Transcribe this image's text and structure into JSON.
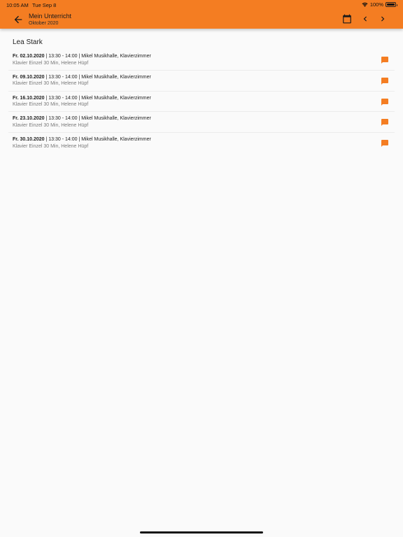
{
  "status": {
    "time": "10:05 AM",
    "date": "Tue Sep 8",
    "battery": "100%"
  },
  "header": {
    "title": "Mein Unterricht",
    "subtitle": "Oktober 2020",
    "icons": [
      "arrow-back-icon",
      "calendar-icon",
      "chevron-left-icon",
      "chevron-right-icon"
    ]
  },
  "student": {
    "name": "Lea Stark"
  },
  "lessons": [
    {
      "date": "Fr. 02.10.2020",
      "details": " | 13:30 - 14:00 | Mikel Musikhalle, Klavierzimmer",
      "subline": "Klavier Einzel 30 Min, Helene Hüpf"
    },
    {
      "date": "Fr. 09.10.2020",
      "details": " | 13:30 - 14:00 | Mikel Musikhalle, Klavierzimmer",
      "subline": "Klavier Einzel 30 Min, Helene Hüpf"
    },
    {
      "date": "Fr. 16.10.2020",
      "details": " | 13:30 - 14:00 | Mikel Musikhalle, Klavierzimmer",
      "subline": "Klavier Einzel 30 Min, Helene Hüpf"
    },
    {
      "date": "Fr. 23.10.2020",
      "details": " | 13:30 - 14:00 | Mikel Musikhalle, Klavierzimmer",
      "subline": "Klavier Einzel 30 Min, Helene Hüpf"
    },
    {
      "date": "Fr. 30.10.2020",
      "details": " | 13:30 - 14:00 | Mikel Musikhalle, Klavierzimmer",
      "subline": "Klavier Einzel 30 Min, Helene Hüpf"
    }
  ],
  "colors": {
    "accent": "#f47d22",
    "background": "#fafafa",
    "comment_icon": "#f47d22"
  }
}
